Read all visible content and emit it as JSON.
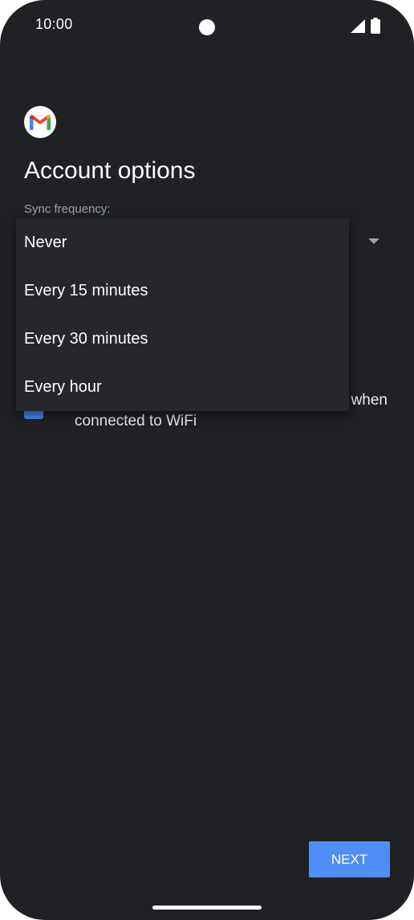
{
  "status_bar": {
    "time": "10:00",
    "icons": [
      "signal-icon",
      "battery-icon"
    ]
  },
  "header": {
    "logo_icon": "gmail-icon",
    "title": "Account options"
  },
  "sync": {
    "label": "Sync frequency:",
    "options": [
      "Never",
      "Every 15 minutes",
      "Every 30 minutes",
      "Every hour"
    ]
  },
  "download_option": {
    "text_line1": "when",
    "text_line2": "connected to WiFi",
    "checked": true
  },
  "footer": {
    "next_label": "NEXT"
  },
  "colors": {
    "background": "#202124",
    "accent": "#4f8ef7",
    "popup": "#26272b"
  }
}
